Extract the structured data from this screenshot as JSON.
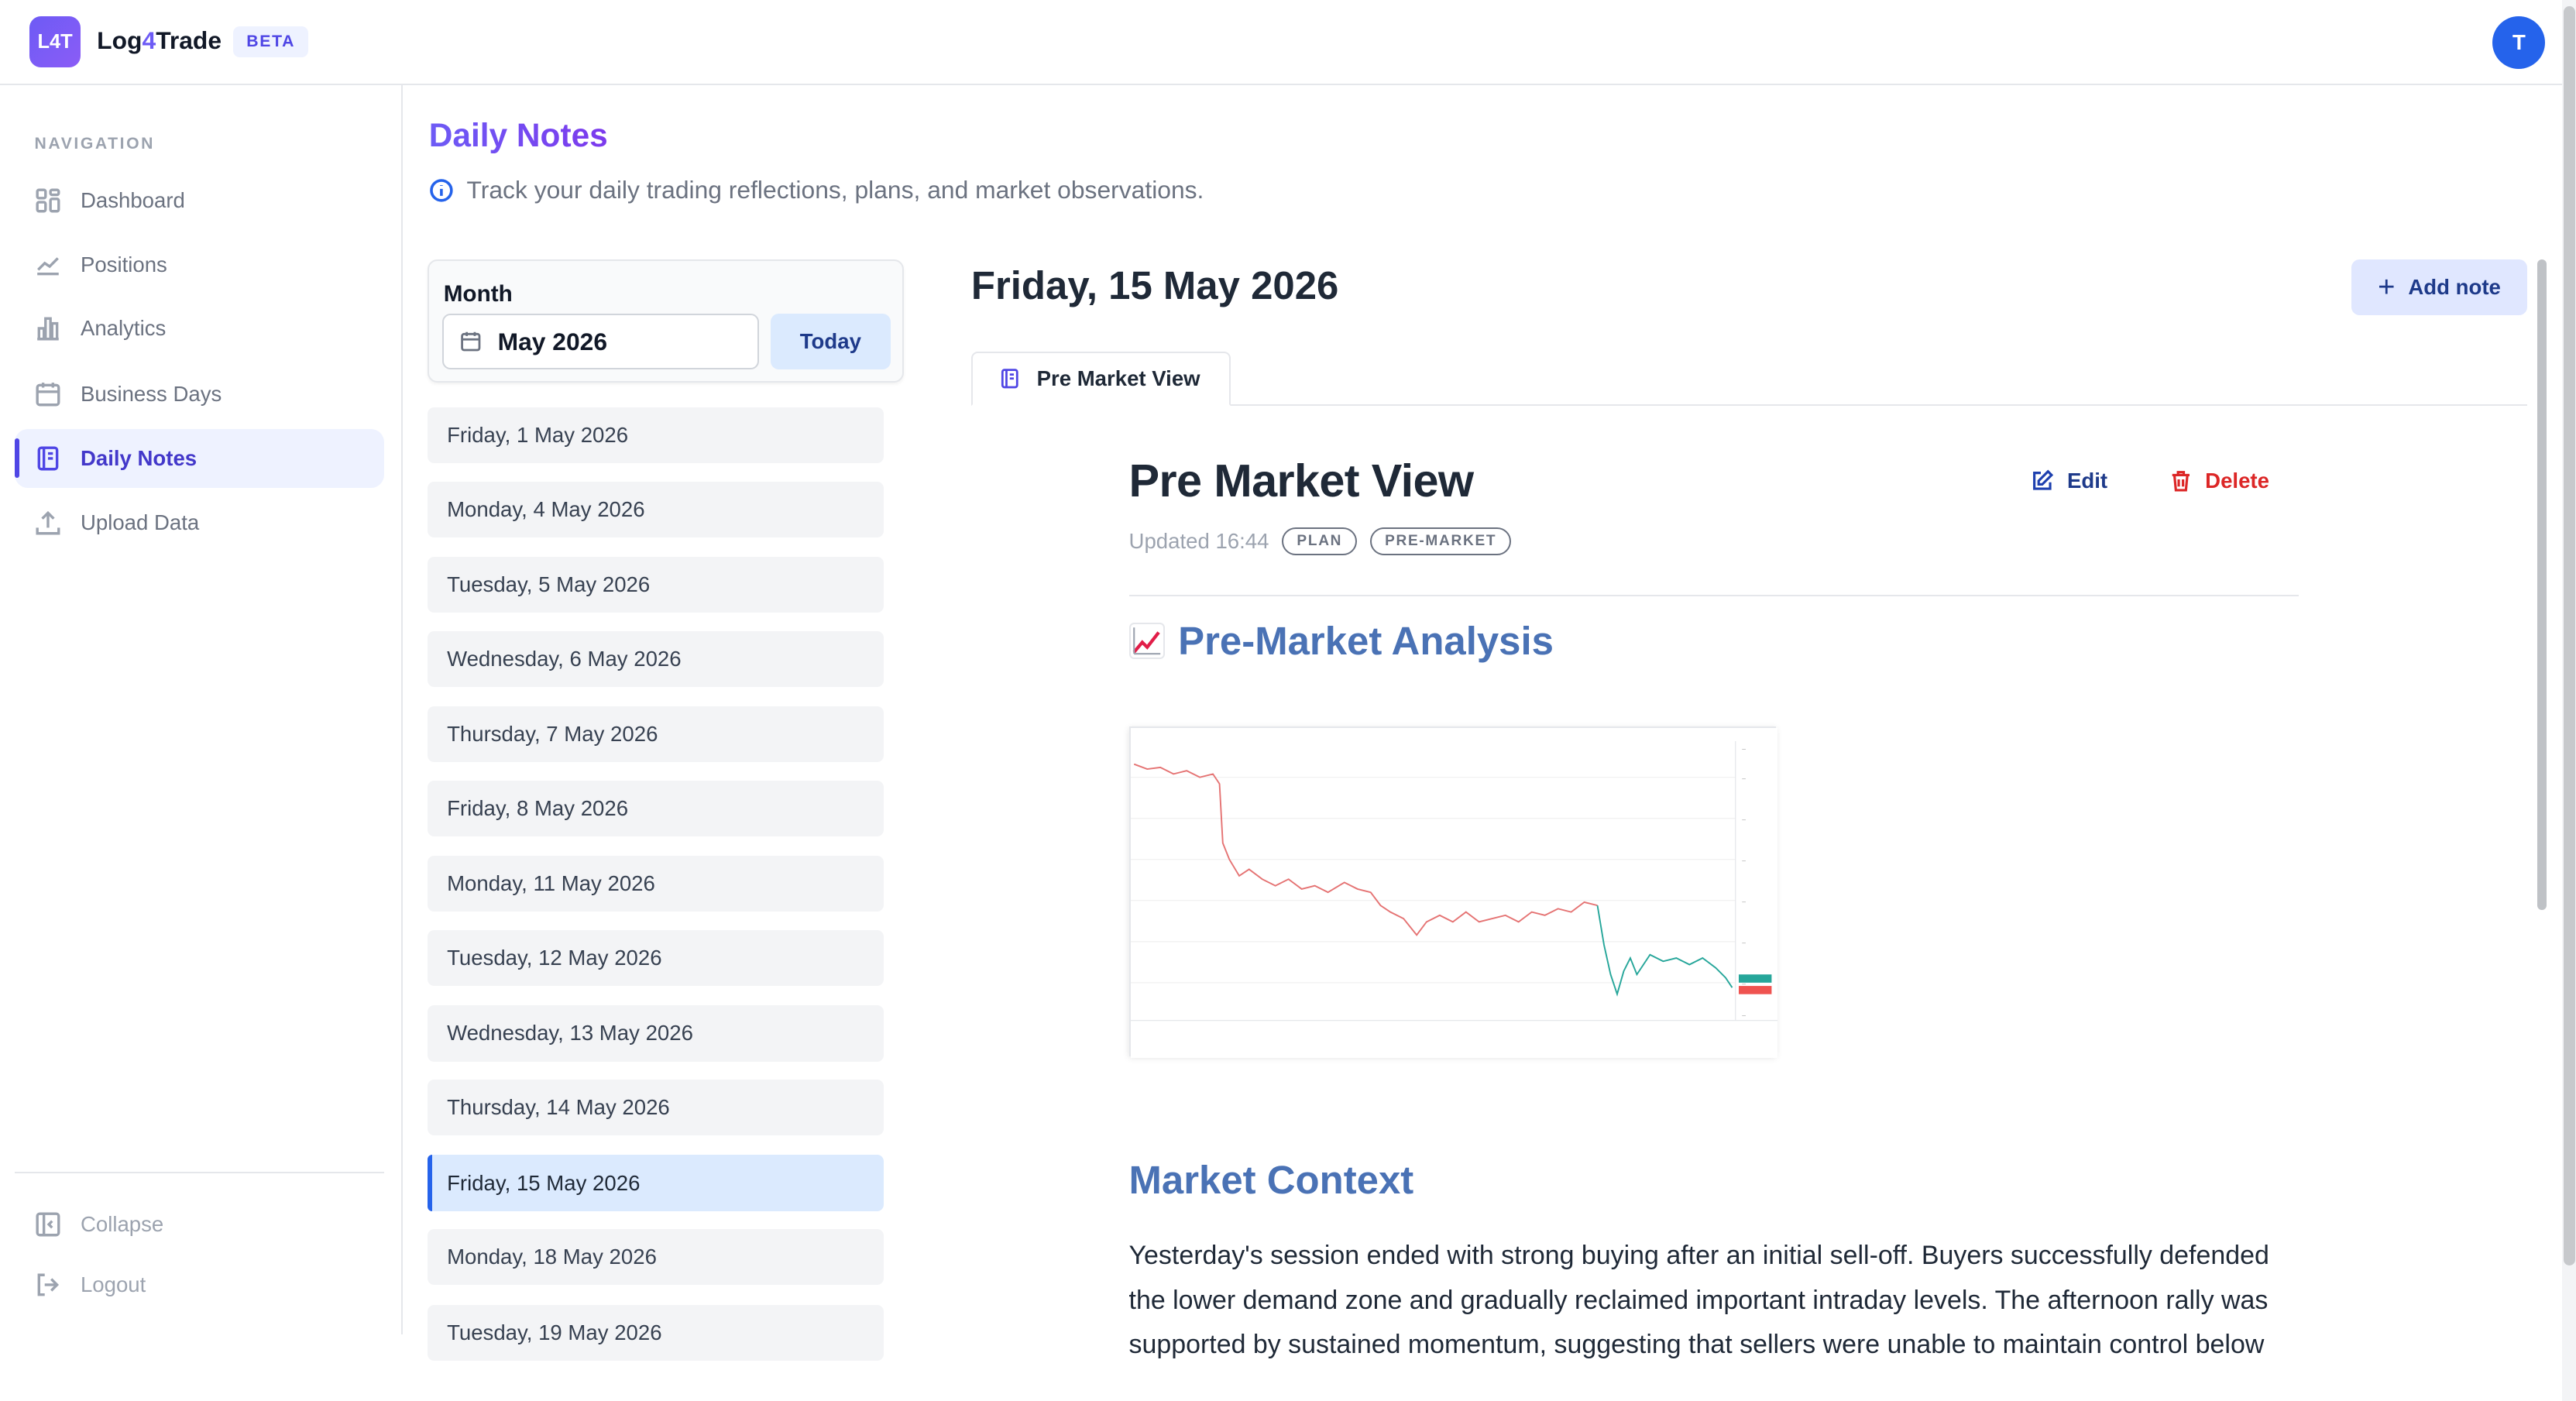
{
  "app": {
    "logo_text": "L4T",
    "brand_prefix": "Log",
    "brand_four": "4",
    "brand_suffix": "Trade",
    "beta_label": "BETA",
    "avatar_initial": "T"
  },
  "sidebar": {
    "heading": "NAVIGATION",
    "items": [
      {
        "label": "Dashboard",
        "icon": "dashboard-icon"
      },
      {
        "label": "Positions",
        "icon": "line-chart-icon"
      },
      {
        "label": "Analytics",
        "icon": "bar-chart-icon"
      },
      {
        "label": "Business Days",
        "icon": "calendar-icon"
      },
      {
        "label": "Daily Notes",
        "icon": "notebook-icon",
        "active": true
      },
      {
        "label": "Upload Data",
        "icon": "upload-icon"
      }
    ],
    "collapse_label": "Collapse",
    "logout_label": "Logout"
  },
  "page": {
    "title": "Daily Notes",
    "subtitle": "Track your daily trading reflections, plans, and market observations."
  },
  "month_picker": {
    "label": "Month",
    "value": "May 2026",
    "today_label": "Today"
  },
  "dates": [
    "Friday, 1 May 2026",
    "Monday, 4 May 2026",
    "Tuesday, 5 May 2026",
    "Wednesday, 6 May 2026",
    "Thursday, 7 May 2026",
    "Friday, 8 May 2026",
    "Monday, 11 May 2026",
    "Tuesday, 12 May 2026",
    "Wednesday, 13 May 2026",
    "Thursday, 14 May 2026",
    "Friday, 15 May 2026",
    "Monday, 18 May 2026",
    "Tuesday, 19 May 2026"
  ],
  "selected_date_index": 10,
  "note_panel": {
    "day_title": "Friday, 15 May 2026",
    "add_note_label": "Add note",
    "tab_label": "Pre Market View",
    "note_title": "Pre Market View",
    "edit_label": "Edit",
    "delete_label": "Delete",
    "updated_text": "Updated 16:44",
    "tags": [
      "PLAN",
      "PRE-MARKET"
    ],
    "heading_analysis": "Pre-Market Analysis",
    "heading_context": "Market Context",
    "body_text": "Yesterday's session ended with strong buying after an initial sell-off. Buyers successfully defended the lower demand zone and gradually reclaimed important intraday levels. The afternoon rally was supported by sustained momentum, suggesting that sellers were unable to maintain control below"
  },
  "colors": {
    "accent": "#6d5bf5",
    "primary_blue": "#2563eb",
    "heading_blue": "#4a72b5",
    "danger": "#dc2626"
  }
}
